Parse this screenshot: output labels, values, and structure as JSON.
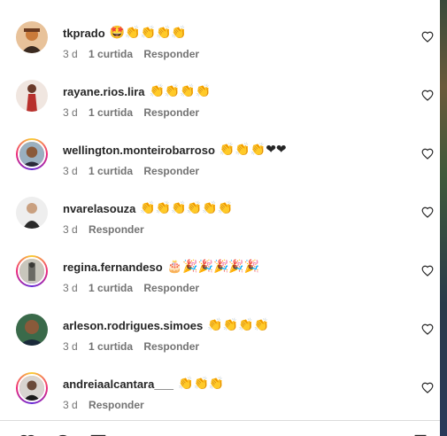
{
  "comments": [
    {
      "username": "tkprado",
      "emojis": "🤩👏👏👏👏",
      "time": "3 d",
      "likes": "1 curtida",
      "reply": "Responder",
      "ring": false,
      "avatar_color": "#c97a3a"
    },
    {
      "username": "rayane.rios.lira",
      "emojis": "👏👏👏👏",
      "time": "3 d",
      "likes": "1 curtida",
      "reply": "Responder",
      "ring": false,
      "avatar_color": "#b8302c"
    },
    {
      "username": "wellington.monteirobarroso",
      "emojis": "👏👏👏❤❤",
      "time": "3 d",
      "likes": "1 curtida",
      "reply": "Responder",
      "ring": true,
      "avatar_color": "#5a3a2a"
    },
    {
      "username": "nvarelasouza",
      "emojis": "👏👏👏👏👏👏",
      "time": "3 d",
      "likes": "",
      "reply": "Responder",
      "ring": false,
      "avatar_color": "#2a2a2a"
    },
    {
      "username": "regina.fernandeso",
      "emojis": "🎂🎉🎉🎉🎉🎉",
      "time": "3 d",
      "likes": "1 curtida",
      "reply": "Responder",
      "ring": true,
      "avatar_color": "#8a8a80"
    },
    {
      "username": "arleson.rodrigues.simoes",
      "emojis": "👏👏👏👏",
      "time": "3 d",
      "likes": "1 curtida",
      "reply": "Responder",
      "ring": false,
      "avatar_color": "#4a3a2a"
    },
    {
      "username": "andreiaalcantara___",
      "emojis": "👏👏👏",
      "time": "3 d",
      "likes": "",
      "reply": "Responder",
      "ring": true,
      "avatar_color": "#2a2020"
    }
  ],
  "colors": {
    "accent_text": "#262626",
    "meta_text": "#737373",
    "clap": "#f2b21a",
    "heart": "#e3223b"
  }
}
